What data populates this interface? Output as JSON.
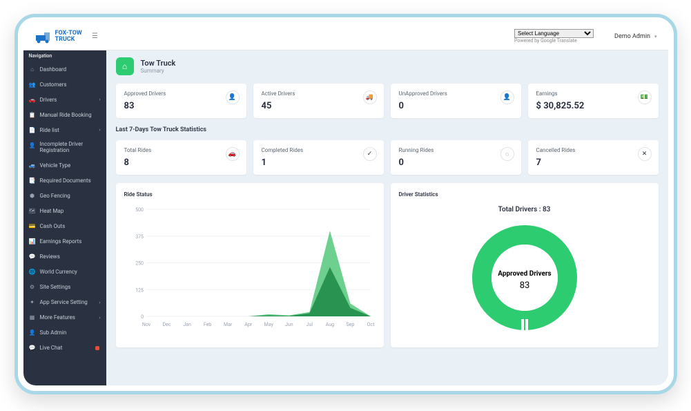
{
  "brand": {
    "line1": "FOX-TOW",
    "line2": "TRUCK"
  },
  "topbar": {
    "lang_select": "Select Language",
    "lang_powered": "Powered by Google Translate",
    "user": "Demo Admin"
  },
  "sidebar": {
    "header": "Navigation",
    "items": [
      {
        "icon": "⌂",
        "label": "Dashboard"
      },
      {
        "icon": "👥",
        "label": "Customers"
      },
      {
        "icon": "🚗",
        "label": "Drivers",
        "chevron": true
      },
      {
        "icon": "📋",
        "label": "Manual Ride Booking"
      },
      {
        "icon": "📄",
        "label": "Ride list",
        "chevron": true
      },
      {
        "icon": "👤",
        "label": "Incomplete Driver Registration",
        "multiline": true
      },
      {
        "icon": "🚙",
        "label": "Vehicle Type"
      },
      {
        "icon": "📑",
        "label": "Required Documents"
      },
      {
        "icon": "⬢",
        "label": "Geo Fencing"
      },
      {
        "icon": "🗺",
        "label": "Heat Map"
      },
      {
        "icon": "💳",
        "label": "Cash Outs"
      },
      {
        "icon": "📊",
        "label": "Earnings Reports"
      },
      {
        "icon": "💬",
        "label": "Reviews"
      },
      {
        "icon": "🌐",
        "label": "World Currency"
      },
      {
        "icon": "⚙",
        "label": "Site Settings"
      },
      {
        "icon": "✦",
        "label": "App Service Setting",
        "chevron": true
      },
      {
        "icon": "▦",
        "label": "More Features",
        "chevron": true
      },
      {
        "icon": "👤",
        "label": "Sub Admin"
      },
      {
        "icon": "💬",
        "label": "Live Chat",
        "badge": true
      }
    ]
  },
  "page": {
    "title": "Tow Truck",
    "subtitle": "Summary"
  },
  "stats1": [
    {
      "label": "Approved Drivers",
      "value": "83",
      "icon": "👤"
    },
    {
      "label": "Active Drivers",
      "value": "45",
      "icon": "🚚"
    },
    {
      "label": "UnApproved Drivers",
      "value": "0",
      "icon": "👤"
    },
    {
      "label": "Earnings",
      "value": "$ 30,825.52",
      "icon": "💵"
    }
  ],
  "section2_label": "Last 7-Days Tow Truck Statistics",
  "stats2": [
    {
      "label": "Total Rides",
      "value": "8",
      "icon": "🚗"
    },
    {
      "label": "Completed Rides",
      "value": "1",
      "icon": "✓"
    },
    {
      "label": "Running Rides",
      "value": "0",
      "icon": "◌"
    },
    {
      "label": "Cancelled Rides",
      "value": "7",
      "icon": "✕"
    }
  ],
  "ride_status": {
    "title": "Ride Status"
  },
  "driver_stats": {
    "title": "Driver Statistics",
    "total_label": "Total Drivers : 83",
    "center_label": "Approved Drivers",
    "center_value": "83"
  },
  "chart_data": [
    {
      "type": "area",
      "title": "Ride Status",
      "xlabel": "",
      "ylabel": "",
      "categories": [
        "Nov",
        "Dec",
        "Jan",
        "Feb",
        "Mar",
        "Apr",
        "May",
        "Jun",
        "Jul",
        "Aug",
        "Sep",
        "Oct"
      ],
      "ylim": [
        0,
        500
      ],
      "yticks": [
        0,
        125,
        250,
        375,
        500
      ],
      "series": [
        {
          "name": "series1",
          "color": "#54c87a",
          "values": [
            0,
            0,
            0,
            0,
            0,
            0,
            10,
            5,
            20,
            400,
            60,
            0
          ]
        },
        {
          "name": "series2",
          "color": "#1d8a46",
          "values": [
            0,
            0,
            0,
            0,
            0,
            0,
            5,
            2,
            15,
            230,
            40,
            0
          ]
        }
      ]
    },
    {
      "type": "pie",
      "title": "Driver Statistics",
      "total": 83,
      "slices": [
        {
          "name": "Approved Drivers",
          "value": 83,
          "color": "#2ecc71"
        }
      ]
    }
  ]
}
